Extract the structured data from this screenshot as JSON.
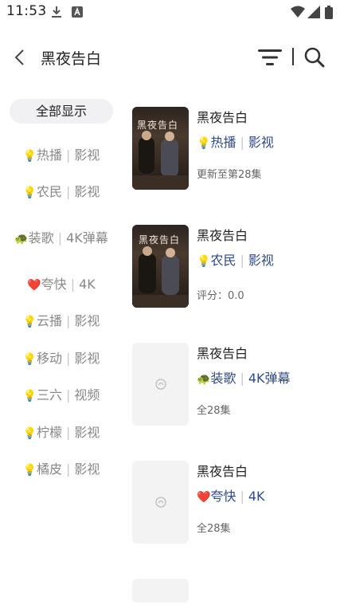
{
  "status_bar": {
    "time": "11:53"
  },
  "header": {
    "title": "黑夜告白"
  },
  "sidebar": {
    "items": [
      {
        "label": "全部显示"
      },
      {
        "icon": "💡",
        "name": "热播",
        "suffix": "影视"
      },
      {
        "icon": "💡",
        "name": "农民",
        "suffix": "影视"
      },
      {
        "icon": "🐢",
        "name": "装歌",
        "suffix": "4K弹幕"
      },
      {
        "icon": "❤️",
        "name": "夸快",
        "suffix": "4K"
      },
      {
        "icon": "💡",
        "name": "云播",
        "suffix": "影视"
      },
      {
        "icon": "💡",
        "name": "移动",
        "suffix": "影视"
      },
      {
        "icon": "💡",
        "name": "三六",
        "suffix": "视频"
      },
      {
        "icon": "💡",
        "name": "柠檬",
        "suffix": "影视"
      },
      {
        "icon": "💡",
        "name": "橘皮",
        "suffix": "影视"
      }
    ]
  },
  "results": [
    {
      "title": "黑夜告白",
      "icon": "💡",
      "source": "热播",
      "suffix": "影视",
      "meta": "更新至第28集",
      "poster_text": "黑夜告白"
    },
    {
      "title": "黑夜告白",
      "icon": "💡",
      "source": "农民",
      "suffix": "影视",
      "meta": "评分：0.0",
      "poster_text": "黑夜告白"
    },
    {
      "title": "黑夜告白",
      "icon": "🐢",
      "source": "装歌",
      "suffix": "4K弹幕",
      "meta": "全28集"
    },
    {
      "title": "黑夜告白",
      "icon": "❤️",
      "source": "夸快",
      "suffix": "4K",
      "meta": "全28集"
    }
  ],
  "colors": {
    "accent_text": "#2f4a8a",
    "active_bg": "#f1f1f3"
  }
}
